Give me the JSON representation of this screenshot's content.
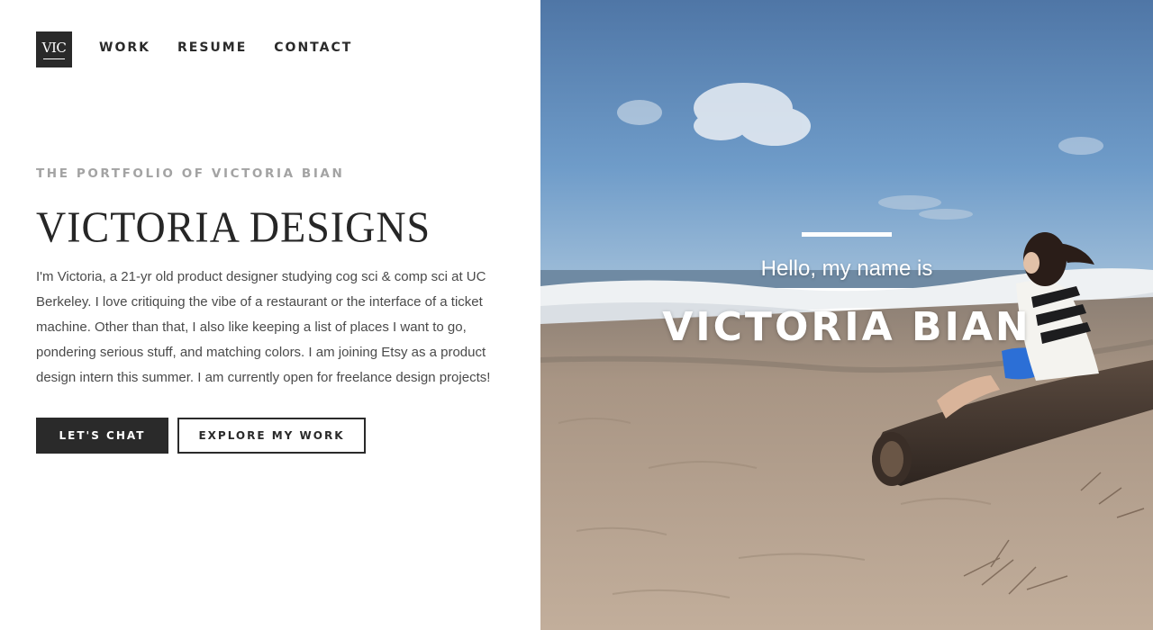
{
  "logo": {
    "text": "VIC"
  },
  "nav": {
    "items": [
      "WORK",
      "RESUME",
      "CONTACT"
    ]
  },
  "intro": {
    "kicker": "THE PORTFOLIO OF VICTORIA BIAN",
    "title": "VICTORIA DESIGNS",
    "body": "I'm Victoria, a 21-yr old product designer studying cog sci & comp sci at UC Berkeley. I love critiquing the vibe of a restaurant or the interface of a ticket machine. Other than that, I also like keeping a list of places I want to go, pondering serious stuff, and matching colors. I am joining Etsy as a product design intern this summer. I am currently open for freelance design projects!"
  },
  "buttons": {
    "chat": "LET'S CHAT",
    "explore": "EXPLORE MY WORK"
  },
  "hero": {
    "greeting": "Hello, my name is",
    "name": "VICTORIA BIAN"
  },
  "colors": {
    "ink": "#2a2a2a",
    "kicker": "#a3a3a3",
    "sky": "#5b86b5",
    "sand": "#b9a592"
  }
}
